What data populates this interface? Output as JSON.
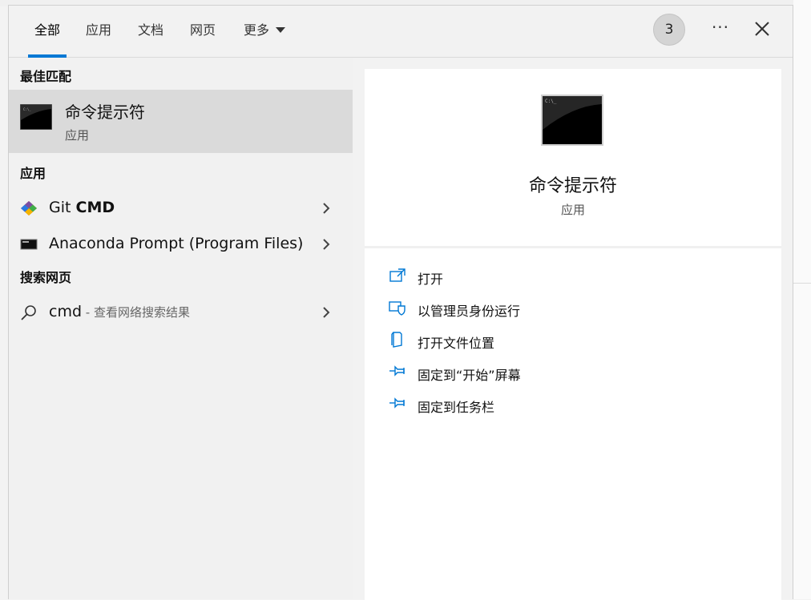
{
  "tabs": [
    {
      "label": "全部",
      "active": true
    },
    {
      "label": "应用"
    },
    {
      "label": "文档"
    },
    {
      "label": "网页"
    },
    {
      "label": "更多"
    }
  ],
  "badge_count": "3",
  "ellipsis": "···",
  "best_match": {
    "header": "最佳匹配",
    "title": "命令提示符",
    "subtitle": "应用"
  },
  "apps": {
    "header": "应用",
    "items": [
      {
        "name_plain": "Git ",
        "name_bold": "CMD"
      },
      {
        "name_plain": "Anaconda Prompt (Program Files)",
        "name_bold": ""
      }
    ]
  },
  "web": {
    "header": "搜索网页",
    "query": "cmd",
    "hint": " - 查看网络搜索结果"
  },
  "preview": {
    "title": "命令提示符",
    "subtitle": "应用",
    "actions": [
      {
        "label": "打开",
        "icon": "open-icon"
      },
      {
        "label": "以管理员身份运行",
        "icon": "shield-icon"
      },
      {
        "label": "打开文件位置",
        "icon": "file-location-icon"
      },
      {
        "label": "固定到“开始”屏幕",
        "icon": "pin-icon"
      },
      {
        "label": "固定到任务栏",
        "icon": "pin-icon"
      }
    ]
  },
  "colors": {
    "accent": "#0078d4",
    "selected_bg": "#dadada",
    "panel_bg": "#f1f1f1"
  }
}
